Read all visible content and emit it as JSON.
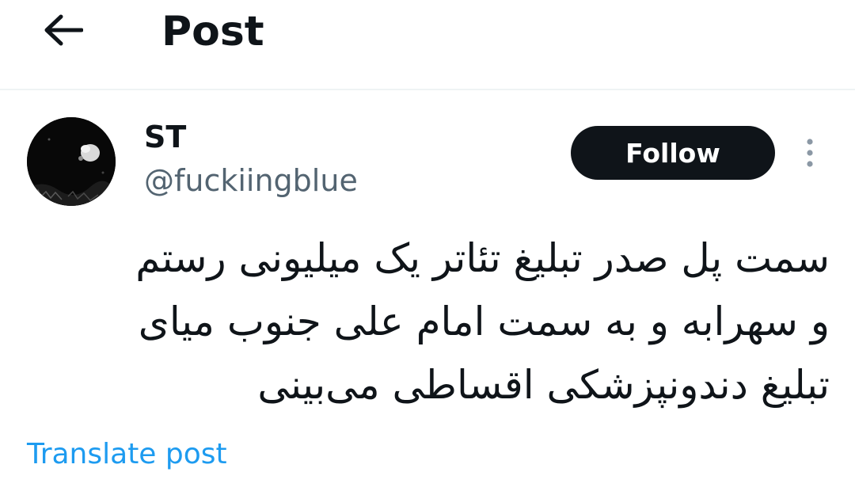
{
  "header": {
    "back_icon": "arrow-left-icon",
    "title": "Post"
  },
  "author": {
    "avatar": "avatar",
    "display_name": "ST",
    "handle": "@fuckiingblue"
  },
  "actions": {
    "follow_label": "Follow",
    "more_icon": "more-vertical-icon"
  },
  "post": {
    "text": "سمت پل صدر تبلیغ تئاتر یک میلیونی رستم و سهرابه و به سمت امام علی جنوب میای تبلیغ دندونپزشکی اقساطی می‌بینی"
  },
  "footer": {
    "translate_label": "Translate post"
  },
  "colors": {
    "text_primary": "#0f1419",
    "text_secondary": "#536471",
    "link": "#1d9bf0",
    "divider": "#eff3f4"
  }
}
